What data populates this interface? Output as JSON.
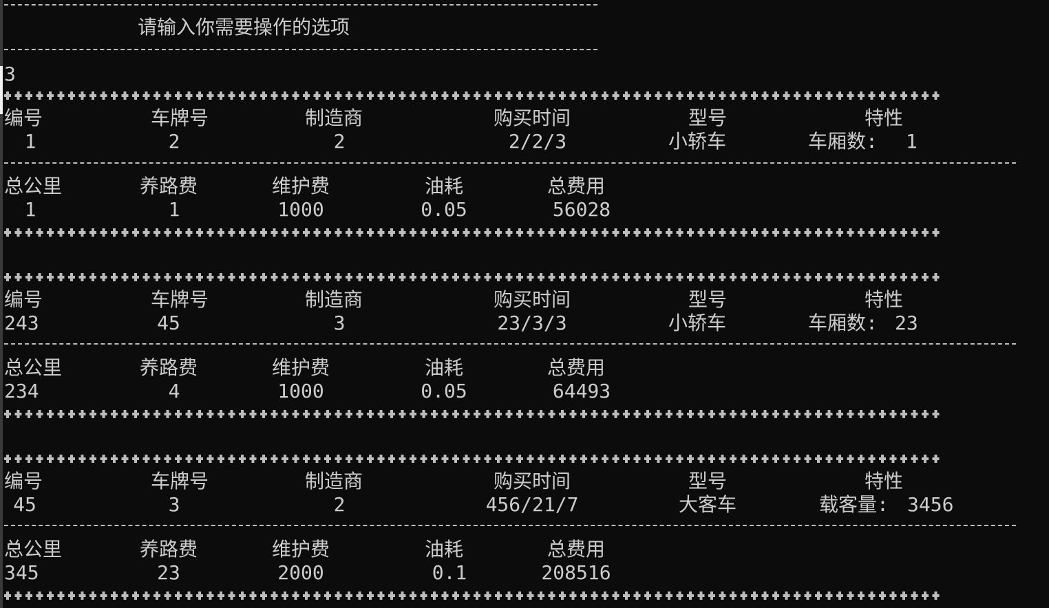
{
  "prompt": "请输入你需要操作的选项",
  "user_input": "3",
  "vehicle_headers": [
    "编号",
    "车牌号",
    "制造商",
    "购买时间",
    "型号",
    "特性"
  ],
  "cost_headers": [
    "总公里",
    "养路费",
    "维护费",
    "油耗",
    "总费用"
  ],
  "vehicles": [
    {
      "id": "1",
      "plate": "2",
      "maker": "2",
      "date": "2/2/3",
      "model": "小轿车",
      "feature_label": "车厢数:",
      "feature_value": "1",
      "km": "1",
      "road_fee": "1",
      "maint_fee": "1000",
      "fuel": "0.05",
      "total": "56028"
    },
    {
      "id": "243",
      "plate": "45",
      "maker": "3",
      "date": "23/3/3",
      "model": "小轿车",
      "feature_label": "车厢数:",
      "feature_value": "23",
      "km": "234",
      "road_fee": "4",
      "maint_fee": "1000",
      "fuel": "0.05",
      "total": "64493"
    },
    {
      "id": "45",
      "plate": "3",
      "maker": "2",
      "date": "456/21/7",
      "model": "大客车",
      "feature_label": "载客量:",
      "feature_value": "3456",
      "km": "345",
      "road_fee": "23",
      "maint_fee": "2000",
      "fuel": "0.1",
      "total": "208516"
    }
  ]
}
